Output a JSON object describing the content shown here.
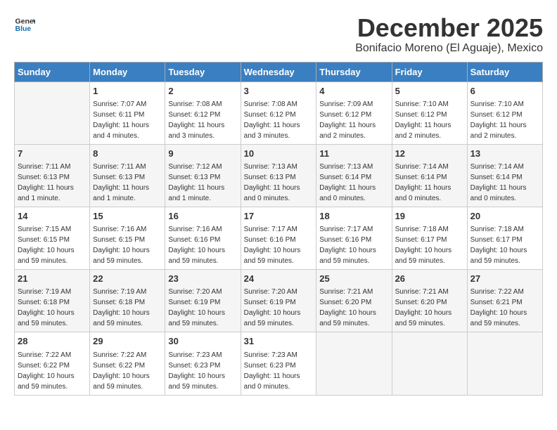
{
  "header": {
    "logo_line1": "General",
    "logo_line2": "Blue",
    "title": "December 2025",
    "subtitle": "Bonifacio Moreno (El Aguaje), Mexico"
  },
  "weekdays": [
    "Sunday",
    "Monday",
    "Tuesday",
    "Wednesday",
    "Thursday",
    "Friday",
    "Saturday"
  ],
  "weeks": [
    [
      {
        "day": "",
        "info": ""
      },
      {
        "day": "1",
        "info": "Sunrise: 7:07 AM\nSunset: 6:11 PM\nDaylight: 11 hours\nand 4 minutes."
      },
      {
        "day": "2",
        "info": "Sunrise: 7:08 AM\nSunset: 6:12 PM\nDaylight: 11 hours\nand 3 minutes."
      },
      {
        "day": "3",
        "info": "Sunrise: 7:08 AM\nSunset: 6:12 PM\nDaylight: 11 hours\nand 3 minutes."
      },
      {
        "day": "4",
        "info": "Sunrise: 7:09 AM\nSunset: 6:12 PM\nDaylight: 11 hours\nand 2 minutes."
      },
      {
        "day": "5",
        "info": "Sunrise: 7:10 AM\nSunset: 6:12 PM\nDaylight: 11 hours\nand 2 minutes."
      },
      {
        "day": "6",
        "info": "Sunrise: 7:10 AM\nSunset: 6:12 PM\nDaylight: 11 hours\nand 2 minutes."
      }
    ],
    [
      {
        "day": "7",
        "info": "Sunrise: 7:11 AM\nSunset: 6:13 PM\nDaylight: 11 hours\nand 1 minute."
      },
      {
        "day": "8",
        "info": "Sunrise: 7:11 AM\nSunset: 6:13 PM\nDaylight: 11 hours\nand 1 minute."
      },
      {
        "day": "9",
        "info": "Sunrise: 7:12 AM\nSunset: 6:13 PM\nDaylight: 11 hours\nand 1 minute."
      },
      {
        "day": "10",
        "info": "Sunrise: 7:13 AM\nSunset: 6:13 PM\nDaylight: 11 hours\nand 0 minutes."
      },
      {
        "day": "11",
        "info": "Sunrise: 7:13 AM\nSunset: 6:14 PM\nDaylight: 11 hours\nand 0 minutes."
      },
      {
        "day": "12",
        "info": "Sunrise: 7:14 AM\nSunset: 6:14 PM\nDaylight: 11 hours\nand 0 minutes."
      },
      {
        "day": "13",
        "info": "Sunrise: 7:14 AM\nSunset: 6:14 PM\nDaylight: 11 hours\nand 0 minutes."
      }
    ],
    [
      {
        "day": "14",
        "info": "Sunrise: 7:15 AM\nSunset: 6:15 PM\nDaylight: 10 hours\nand 59 minutes."
      },
      {
        "day": "15",
        "info": "Sunrise: 7:16 AM\nSunset: 6:15 PM\nDaylight: 10 hours\nand 59 minutes."
      },
      {
        "day": "16",
        "info": "Sunrise: 7:16 AM\nSunset: 6:16 PM\nDaylight: 10 hours\nand 59 minutes."
      },
      {
        "day": "17",
        "info": "Sunrise: 7:17 AM\nSunset: 6:16 PM\nDaylight: 10 hours\nand 59 minutes."
      },
      {
        "day": "18",
        "info": "Sunrise: 7:17 AM\nSunset: 6:16 PM\nDaylight: 10 hours\nand 59 minutes."
      },
      {
        "day": "19",
        "info": "Sunrise: 7:18 AM\nSunset: 6:17 PM\nDaylight: 10 hours\nand 59 minutes."
      },
      {
        "day": "20",
        "info": "Sunrise: 7:18 AM\nSunset: 6:17 PM\nDaylight: 10 hours\nand 59 minutes."
      }
    ],
    [
      {
        "day": "21",
        "info": "Sunrise: 7:19 AM\nSunset: 6:18 PM\nDaylight: 10 hours\nand 59 minutes."
      },
      {
        "day": "22",
        "info": "Sunrise: 7:19 AM\nSunset: 6:18 PM\nDaylight: 10 hours\nand 59 minutes."
      },
      {
        "day": "23",
        "info": "Sunrise: 7:20 AM\nSunset: 6:19 PM\nDaylight: 10 hours\nand 59 minutes."
      },
      {
        "day": "24",
        "info": "Sunrise: 7:20 AM\nSunset: 6:19 PM\nDaylight: 10 hours\nand 59 minutes."
      },
      {
        "day": "25",
        "info": "Sunrise: 7:21 AM\nSunset: 6:20 PM\nDaylight: 10 hours\nand 59 minutes."
      },
      {
        "day": "26",
        "info": "Sunrise: 7:21 AM\nSunset: 6:20 PM\nDaylight: 10 hours\nand 59 minutes."
      },
      {
        "day": "27",
        "info": "Sunrise: 7:22 AM\nSunset: 6:21 PM\nDaylight: 10 hours\nand 59 minutes."
      }
    ],
    [
      {
        "day": "28",
        "info": "Sunrise: 7:22 AM\nSunset: 6:22 PM\nDaylight: 10 hours\nand 59 minutes."
      },
      {
        "day": "29",
        "info": "Sunrise: 7:22 AM\nSunset: 6:22 PM\nDaylight: 10 hours\nand 59 minutes."
      },
      {
        "day": "30",
        "info": "Sunrise: 7:23 AM\nSunset: 6:23 PM\nDaylight: 10 hours\nand 59 minutes."
      },
      {
        "day": "31",
        "info": "Sunrise: 7:23 AM\nSunset: 6:23 PM\nDaylight: 11 hours\nand 0 minutes."
      },
      {
        "day": "",
        "info": ""
      },
      {
        "day": "",
        "info": ""
      },
      {
        "day": "",
        "info": ""
      }
    ]
  ]
}
